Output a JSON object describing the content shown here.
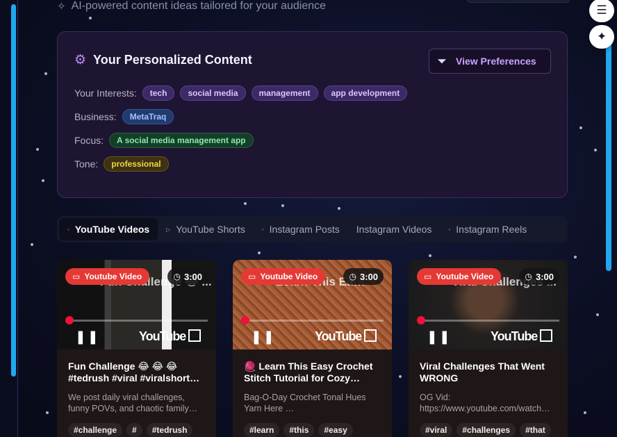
{
  "header": {
    "subtitle": "AI-powered content ideas tailored for your audience"
  },
  "personalized": {
    "title": "Your Personalized Content",
    "view_preferences_label": "View Preferences",
    "interests_label": "Your Interests:",
    "interests": [
      "tech",
      "social media",
      "management",
      "app development"
    ],
    "business_label": "Business:",
    "business": "MetaTraq",
    "focus_label": "Focus:",
    "focus": "A social media management app",
    "tone_label": "Tone:",
    "tone": "professional"
  },
  "tabs": [
    {
      "label": "YouTube Videos",
      "active": true
    },
    {
      "label": "YouTube Shorts",
      "active": false
    },
    {
      "label": "Instagram Posts",
      "active": false
    },
    {
      "label": "Instagram Videos",
      "active": false
    },
    {
      "label": "Instagram Reels",
      "active": false
    }
  ],
  "cards": [
    {
      "badge": "Youtube Video",
      "duration": "3:00",
      "overlay_title": "Fun Challenge 😂 ...",
      "player_logo": "YouTube",
      "title": "Fun Challenge 😂 😂 😂 #tedrush #viral #viralshort…",
      "description": "We post daily viral challenges, funny POVs, and chaotic family…",
      "tags": [
        "#challenge",
        "#",
        "#tedrush"
      ]
    },
    {
      "badge": "Youtube Video",
      "duration": "3:00",
      "overlay_title": "Learn This Ea…",
      "player_logo": "YouTube",
      "title": "🧶 Learn This Easy Crochet Stitch Tutorial for Cozy…",
      "description": "Bag-O-Day Crochet Tonal Hues Yarn Here …",
      "tags": [
        "#learn",
        "#this",
        "#easy"
      ]
    },
    {
      "badge": "Youtube Video",
      "duration": "3:00",
      "overlay_title": "Viral Challenges ...",
      "player_logo": "YouTube",
      "title": "Viral Challenges That Went WRONG",
      "description": "OG Vid: https://www.youtube.com/watch…",
      "tags": [
        "#viral",
        "#challenges",
        "#that"
      ]
    }
  ],
  "colors": {
    "accent": "#1fa8f0",
    "badge_red": "#e53935",
    "primary_purple": "#c9a3ff"
  }
}
